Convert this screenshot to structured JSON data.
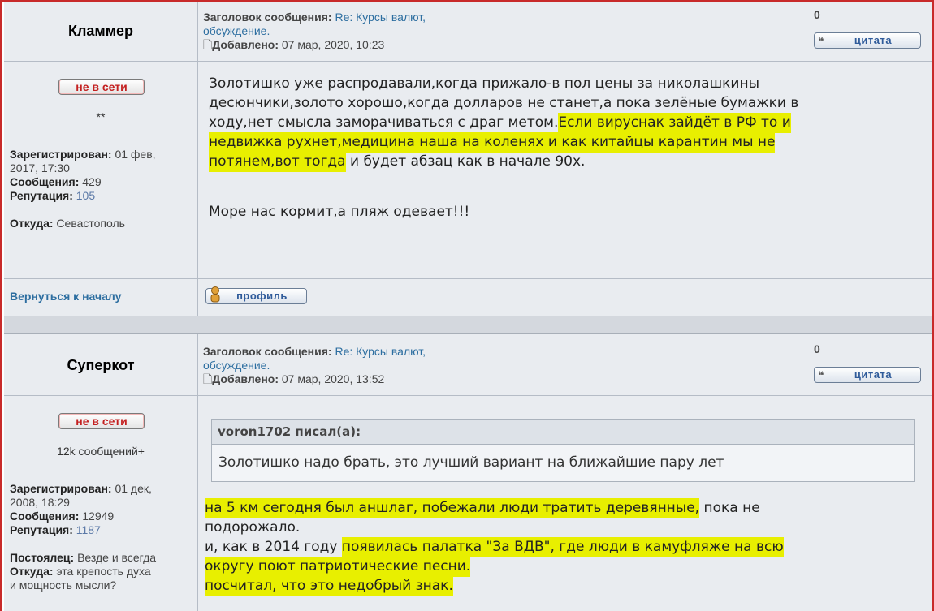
{
  "posts": [
    {
      "author": "Кламмер",
      "status_label": "не в сети",
      "rank": "**",
      "subject_label": "Заголовок сообщения:",
      "subject_value_1": "Re: Курсы валют,",
      "subject_value_2": "обсуждение.",
      "added_label": "Добавлено:",
      "added_value": "07 мар, 2020, 10:23",
      "count": "0",
      "quote_button": "цитата",
      "registered_label": "Зарегистрирован:",
      "registered_value_1": "01 фев,",
      "registered_value_2": "2017, 17:30",
      "messages_label": "Сообщения:",
      "messages_value": "429",
      "reputation_label": "Репутация:",
      "reputation_value": "105",
      "from_label": "Откуда:",
      "from_value": "Севастополь",
      "body_line1": "Золотишко уже распродавали,когда прижало-в пол цены за николашкины",
      "body_line2": "десюнчики,золото хорошо,когда долларов не станет,а пока зелёные бумажки в",
      "body_line3_plain": "ходу,нет смысла заморачиваться с драг метом.",
      "body_line3_hl": "Если вируснак зайдёт в РФ то и",
      "body_line4_hl": "недвижка рухнет,медицина наша на коленях и как китайцы карантин мы не",
      "body_line5_hl": "потянем,вот тогда",
      "body_line5_plain": " и будет абзац как в начале 90х.",
      "signature": "Море нас кормит,а пляж одевает!!!",
      "back_link": "Вернуться к началу",
      "profile_button": "профиль"
    },
    {
      "author": "Суперкот",
      "status_label": "не в сети",
      "rank": "12k сообщений+",
      "subject_label": "Заголовок сообщения:",
      "subject_value_1": "Re: Курсы валют,",
      "subject_value_2": "обсуждение.",
      "added_label": "Добавлено:",
      "added_value": "07 мар, 2020, 13:52",
      "count": "0",
      "quote_button": "цитата",
      "registered_label": "Зарегистрирован:",
      "registered_value_1": "01 дек,",
      "registered_value_2": "2008, 18:29",
      "messages_label": "Сообщения:",
      "messages_value": "12949",
      "reputation_label": "Репутация:",
      "reputation_value": "1187",
      "resident_label": "Постоялец:",
      "resident_value": "Везде и всегда",
      "from_label": "Откуда:",
      "from_value_1": "эта крепость духа",
      "from_value_2": "и мощность мысли?",
      "quote_author": "voron1702 писал(а):",
      "quote_text": "Золотишко надо брать, это лучший вариант на ближайшие пару лет",
      "body_line1_hl": "на 5 км сегодня был аншлаг, побежали люди тратить деревянные,",
      "body_line1_plain": " пока не",
      "body_line2": "подорожало.",
      "body_line3_plain": "и, как в 2014 году ",
      "body_line3_hl": "появилась палатка \"За ВДВ\", где люди в камуфляже на всю",
      "body_line4_hl": "округу поют патриотические песни.",
      "body_line5_hl": "посчитал, что это недобрый знак."
    }
  ],
  "colors": {
    "link": "#2d6ea0",
    "highlight": "#e8ef00",
    "offline": "#c42020",
    "frame": "#c82a2a"
  }
}
